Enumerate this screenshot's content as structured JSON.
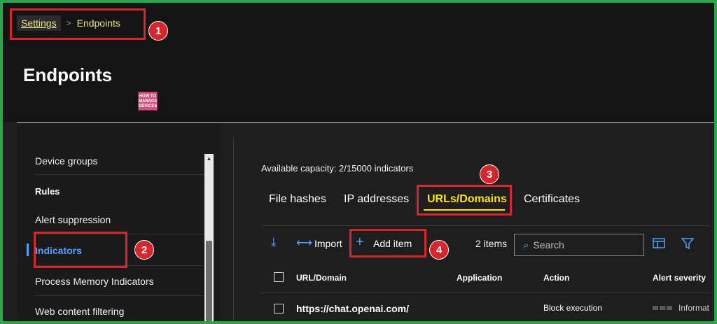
{
  "breadcrumb": {
    "parent": "Settings",
    "separator": ">",
    "current": "Endpoints"
  },
  "page": {
    "title": "Endpoints",
    "logo_text": "HOW TO MANAGE DEVICES"
  },
  "sidebar": {
    "items": [
      {
        "label": "Device groups"
      },
      {
        "label": "Alert suppression"
      },
      {
        "label": "Indicators"
      },
      {
        "label": "Process Memory Indicators"
      },
      {
        "label": "Web content filtering"
      }
    ],
    "section_rules": "Rules"
  },
  "main": {
    "capacity": "Available capacity: 2/15000 indicators",
    "tabs": [
      {
        "label": "File hashes"
      },
      {
        "label": "IP addresses"
      },
      {
        "label": "URLs/Domains"
      },
      {
        "label": "Certificates"
      }
    ],
    "toolbar": {
      "export_icon": "⤓",
      "import_label": "Import",
      "add_label": "Add item",
      "items_count": "2 items",
      "search_placeholder": "Search"
    },
    "table": {
      "columns": [
        "URL/Domain",
        "Application",
        "Action",
        "Alert severity"
      ],
      "rows": [
        {
          "url": "https://chat.openai.com/",
          "application": "",
          "action": "Block execution",
          "severity": "Informat"
        }
      ]
    }
  },
  "annotations": [
    "1",
    "2",
    "3",
    "4"
  ],
  "colors": {
    "accent": "#4fa1ff",
    "tab_active": "#ffe600",
    "callout": "#d7262b",
    "frame": "#2aa64a"
  }
}
